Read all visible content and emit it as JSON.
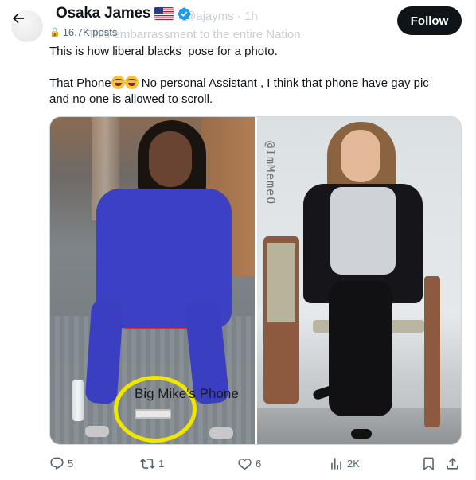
{
  "header": {
    "back_icon": "arrow-left-icon",
    "author_name": "Osaka James",
    "author_flag": "us-flag-icon",
    "verified_icon": "verified-badge-icon",
    "post_count": "16.7K posts",
    "ghost_handle": "@ajayms · 1h",
    "ghost_subtitle": "This embarrassment to the entire Nation",
    "follow_label": "Follow"
  },
  "tweet": {
    "line1": "This is how liberal blacks  pose for a photo.",
    "line2_before": "That Phone",
    "line2_after": " No personal Assistant , I think that phone have gay pic",
    "line3": "and no one is allowed to scroll.",
    "emoji_names": [
      "rolling-on-floor-laughing-emoji",
      "rolling-on-floor-laughing-emoji"
    ]
  },
  "media": {
    "left_caption": "Big Mike's Phone",
    "watermark": "@ImMemeO"
  },
  "actions": {
    "reply_count": "5",
    "retweet_count": "1",
    "like_count": "6",
    "views_count": "2K",
    "accent": "#536471"
  },
  "colors": {
    "follow_bg": "#0f1419",
    "verified_blue": "#1d9bf0",
    "highlight_ring": "#f0e600",
    "suit_blue": "#3b40c4"
  }
}
